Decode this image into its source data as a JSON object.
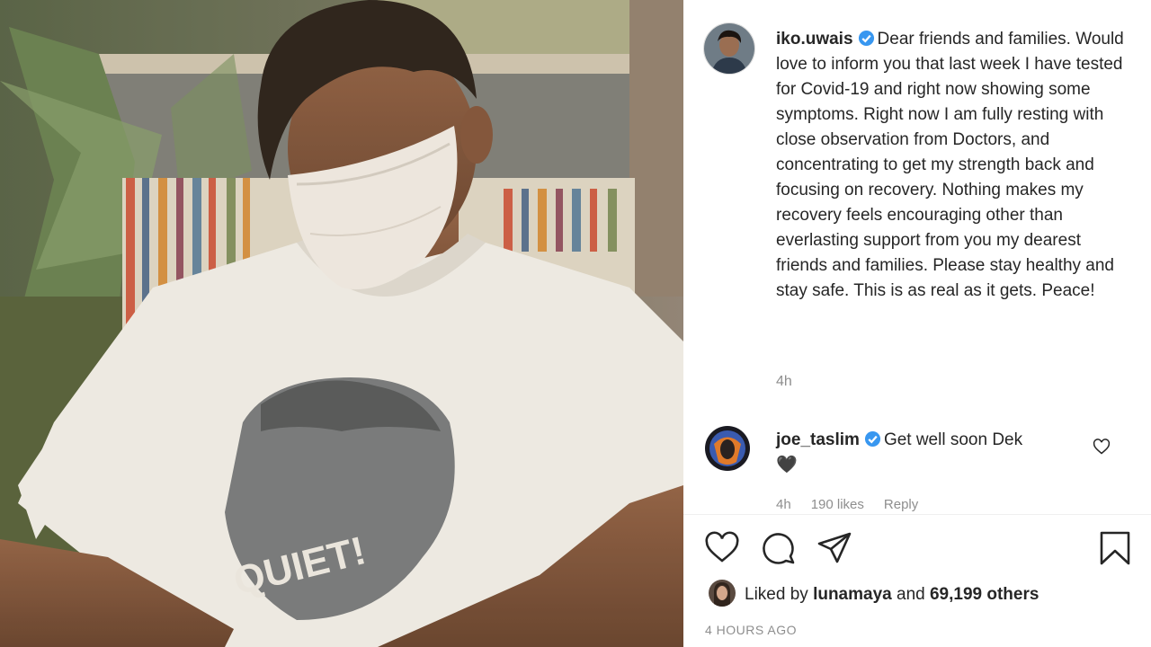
{
  "post": {
    "author": "iko.uwais",
    "caption": "Dear friends and families. Would love to inform you that last week I have tested for Covid-19 and right now showing some symptoms. Right now I am fully resting with close observation from Doctors, and concentrating to get my strength back and focusing on recovery. Nothing makes my recovery feels encouraging other than everlasting support from you my dearest friends and families. Please stay healthy and stay safe. This is as real as it gets. Peace!",
    "time": "4h",
    "shirt_text": "QUIET!"
  },
  "comment": {
    "author": "joe_taslim",
    "text": "Get well soon Dek",
    "emoji": "🖤",
    "time": "4h",
    "likes": "190 likes",
    "reply": "Reply"
  },
  "likes": {
    "prefix": "Liked by",
    "user": "lunamaya",
    "connector": "and",
    "others": "69,199 others"
  },
  "posted_ago": "4 HOURS AGO",
  "icons": [
    "heart-icon",
    "comment-icon",
    "share-icon",
    "bookmark-icon",
    "verified-icon"
  ],
  "colors": {
    "verified": "#3897f0",
    "secondary_text": "#8e8e8e",
    "text": "#262626"
  }
}
